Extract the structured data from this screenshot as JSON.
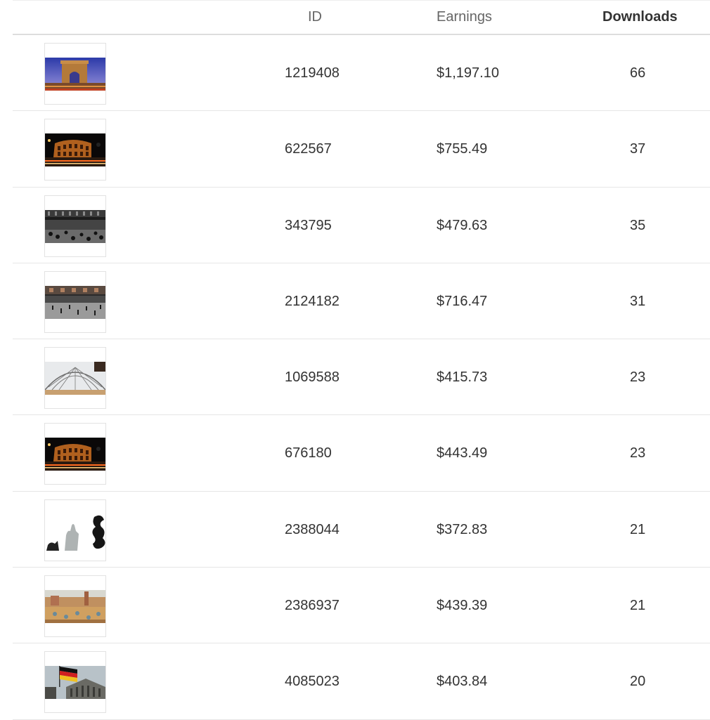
{
  "table": {
    "headers": {
      "image": "",
      "id": "ID",
      "earnings": "Earnings",
      "downloads": "Downloads"
    },
    "sorted_by": "downloads",
    "rows": [
      {
        "thumb": "arc-de-triomphe-thumbnail",
        "id": "1219408",
        "earnings": "$1,197.10",
        "downloads": "66"
      },
      {
        "thumb": "colosseum-night-thumbnail",
        "id": "622567",
        "earnings": "$755.49",
        "downloads": "37"
      },
      {
        "thumb": "train-station-crowd-thumbnail",
        "id": "343795",
        "earnings": "$479.63",
        "downloads": "35"
      },
      {
        "thumb": "train-station-hall-thumbnail",
        "id": "2124182",
        "earnings": "$716.47",
        "downloads": "31"
      },
      {
        "thumb": "glass-dome-gallery-thumbnail",
        "id": "1069588",
        "earnings": "$415.73",
        "downloads": "23"
      },
      {
        "thumb": "colosseum-night-thumbnail",
        "id": "676180",
        "earnings": "$443.49",
        "downloads": "23"
      },
      {
        "thumb": "statues-silhouette-thumbnail",
        "id": "2388044",
        "earnings": "$372.83",
        "downloads": "21"
      },
      {
        "thumb": "park-guell-thumbnail",
        "id": "2386937",
        "earnings": "$439.39",
        "downloads": "21"
      },
      {
        "thumb": "reichstag-flag-thumbnail",
        "id": "4085023",
        "earnings": "$403.84",
        "downloads": "20"
      }
    ]
  }
}
